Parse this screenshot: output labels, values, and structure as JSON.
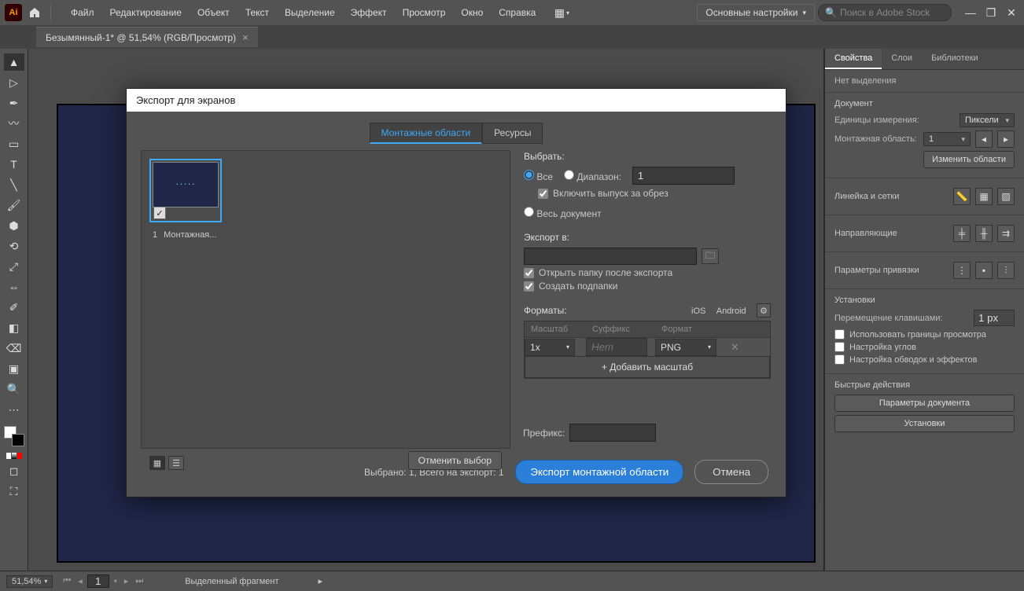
{
  "app": {
    "logo": "Ai",
    "menu": [
      "Файл",
      "Редактирование",
      "Объект",
      "Текст",
      "Выделение",
      "Эффект",
      "Просмотр",
      "Окно",
      "Справка"
    ],
    "workspace": "Основные настройки",
    "search_placeholder": "Поиск в Adobe Stock"
  },
  "doc_tab": "Безымянный-1* @ 51,54% (RGB/Просмотр)",
  "modal": {
    "title": "Экспорт для экранов",
    "tabs": {
      "artboards": "Монтажные области",
      "assets": "Ресурсы"
    },
    "thumb": {
      "index": "1",
      "name": "Монтажная..."
    },
    "clear_selection": "Отменить выбор",
    "select": {
      "title": "Выбрать:",
      "all": "Все",
      "range": "Диапазон:",
      "range_value": "1",
      "include_bleed": "Включить выпуск за обрез",
      "full_doc": "Весь документ"
    },
    "export_to": {
      "title": "Экспорт в:",
      "open_after": "Открыть папку после экспорта",
      "create_sub": "Создать подпапки"
    },
    "formats": {
      "title": "Форматы:",
      "ios": "iOS",
      "android": "Android",
      "head_scale": "Масштаб",
      "head_suffix": "Суффикс",
      "head_format": "Формат",
      "scale": "1x",
      "suffix_placeholder": "Нет",
      "format": "PNG",
      "add_scale": "+ Добавить масштаб"
    },
    "prefix_label": "Префикс:",
    "summary": "Выбрано: 1, Всего на экспорт: 1",
    "export_btn": "Экспорт монтажной области",
    "cancel_btn": "Отмена"
  },
  "props": {
    "tabs": {
      "props": "Свойства",
      "layers": "Слои",
      "libs": "Библиотеки"
    },
    "no_selection": "Нет выделения",
    "document": "Документ",
    "units_label": "Единицы измерения:",
    "units_value": "Пиксели",
    "artboard_label": "Монтажная область:",
    "artboard_value": "1",
    "edit_artboards": "Изменить области",
    "rulers_grids": "Линейка и сетки",
    "guides": "Направляющие",
    "snap_options": "Параметры привязки",
    "prefs": "Установки",
    "key_inc_label": "Перемещение клавишами:",
    "key_inc_value": "1 px",
    "use_preview_bounds": "Использовать границы просмотра",
    "scale_corners": "Настройка углов",
    "scale_strokes": "Настройка обводок и эффектов",
    "quick_actions": "Быстрые действия",
    "doc_setup": "Параметры документа",
    "preferences": "Установки"
  },
  "status": {
    "zoom": "51,54%",
    "page": "1",
    "label": "Выделенный фрагмент"
  }
}
